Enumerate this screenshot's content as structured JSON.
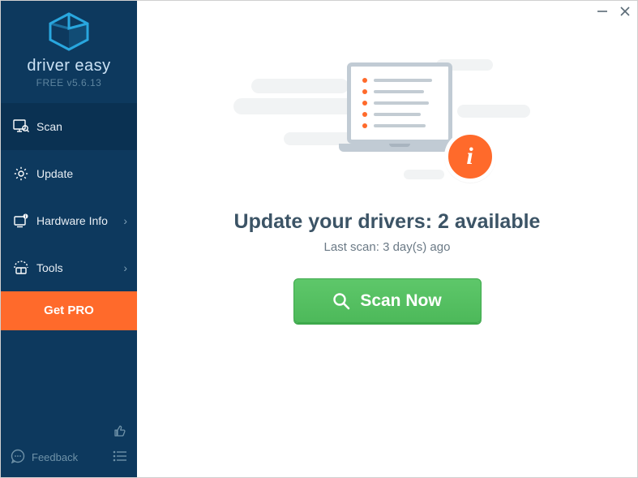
{
  "app": {
    "brand": "driver easy",
    "version": "FREE v5.6.13"
  },
  "nav": {
    "scan": "Scan",
    "update": "Update",
    "hardware": "Hardware Info",
    "tools": "Tools",
    "getpro": "Get PRO"
  },
  "footer": {
    "feedback": "Feedback"
  },
  "main": {
    "headline": "Update your drivers: 2 available",
    "subline": "Last scan: 3 day(s) ago",
    "scan_button": "Scan Now"
  }
}
